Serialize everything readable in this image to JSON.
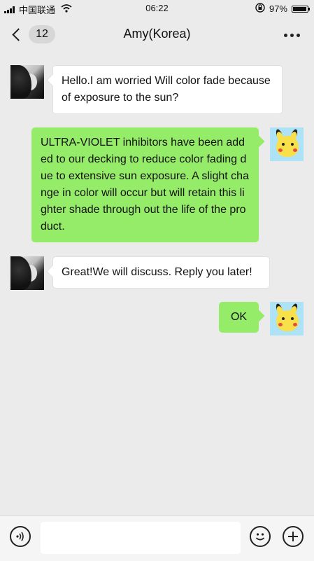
{
  "status_bar": {
    "carrier": "中国联通",
    "time": "06:22",
    "battery": "97%"
  },
  "nav": {
    "back_count": "12",
    "title": "Amy(Korea)"
  },
  "messages": [
    {
      "side": "in",
      "text": "Hello.I am worried Will color fade because of exposure to the sun?"
    },
    {
      "side": "out",
      "text": "ULTRA-VIOLET inhibitors have been added to our decking to reduce color fading due to extensive sun exposure. A slight change in color will occur but will retain this lighter shade through out the life of the product."
    },
    {
      "side": "in",
      "text": "Great!We will discuss. Reply you later!"
    },
    {
      "side": "out",
      "text": "OK"
    }
  ],
  "input": {
    "placeholder": ""
  },
  "icons": {
    "voice": "voice-icon",
    "emoji": "emoji-icon",
    "plus": "plus-icon",
    "back": "chevron-left-icon",
    "more": "more-dots-icon",
    "wifi": "wifi-icon",
    "lock": "rotation-lock-icon",
    "battery": "battery-icon"
  },
  "colors": {
    "outgoing_bubble": "#95ec69",
    "incoming_bubble": "#ffffff",
    "chat_background": "#ebebeb"
  }
}
